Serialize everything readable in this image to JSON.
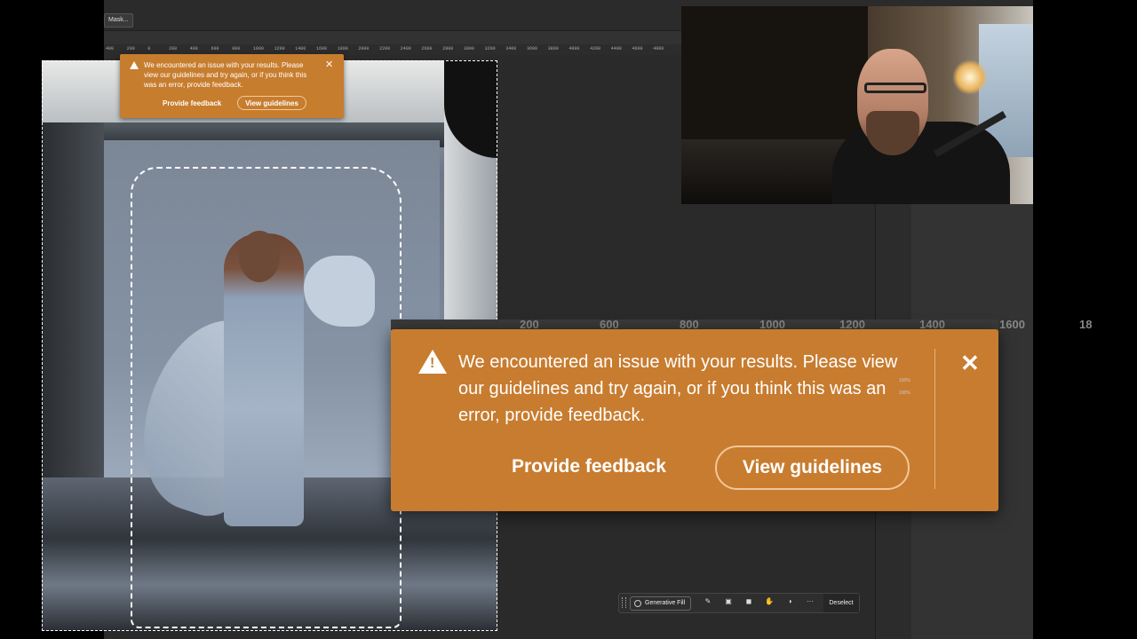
{
  "toolbar": {
    "mask_button": "Mask..."
  },
  "ruler": {
    "ticks": [
      "400",
      "200",
      "0",
      "200",
      "400",
      "600",
      "800",
      "1000",
      "1200",
      "1400",
      "1600",
      "1800",
      "2000",
      "2200",
      "2400",
      "2600",
      "2800",
      "3000",
      "3200",
      "3400",
      "3600",
      "3800",
      "4000",
      "4200",
      "4400",
      "4600",
      "4800"
    ]
  },
  "big_ruler": {
    "ticks": [
      "200",
      "600",
      "800",
      "1000",
      "1200",
      "1400",
      "1600",
      "18"
    ]
  },
  "error_toast": {
    "message": "We encountered an issue with your results. Please view our guidelines and try again, or if you think this was an error, provide feedback.",
    "feedback_label": "Provide feedback",
    "guidelines_label": "View guidelines",
    "close_symbol": "✕",
    "icon": "warning-icon",
    "background_color": "#c87c2f"
  },
  "contextual_taskbar": {
    "generative_fill_label": "Generative Fill",
    "tools": [
      "brush-icon",
      "transform-icon",
      "mask-icon",
      "fill-icon",
      "adjustment-icon",
      "more-icon"
    ],
    "more_symbol": "···",
    "deselect_label": "Deselect"
  },
  "properties_panel": {
    "opacity": "100%",
    "fill": "100%"
  }
}
